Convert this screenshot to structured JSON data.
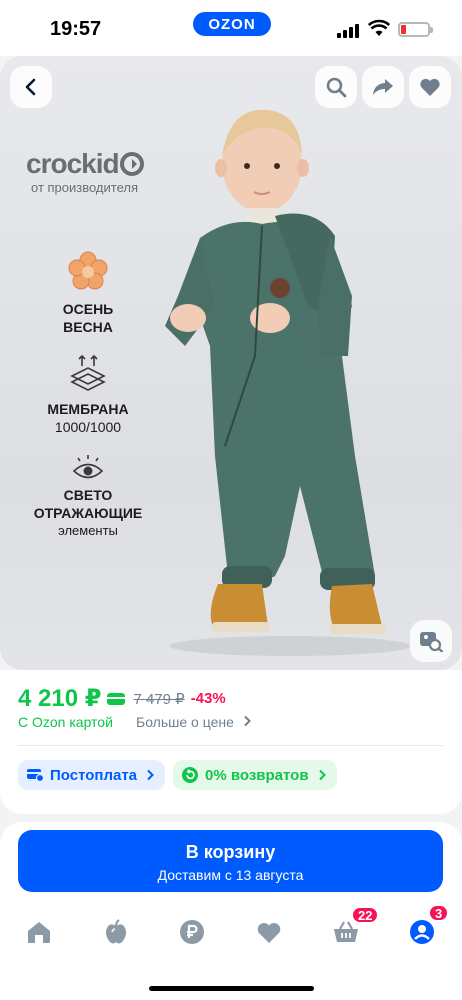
{
  "status": {
    "time": "19:57",
    "app_pill": "OZON"
  },
  "product": {
    "brand": "crockid",
    "brand_sub": "от производителя",
    "features": [
      {
        "icon": "flower-icon",
        "title_line1": "ОСЕНЬ",
        "title_line2": "ВЕСНА",
        "sub": ""
      },
      {
        "icon": "membrane-icon",
        "title_line1": "МЕМБРАНА",
        "title_line2": "1000/1000",
        "sub": ""
      },
      {
        "icon": "eye-icon",
        "title_line1": "СВЕТО",
        "title_line2": "ОТРАЖАЮЩИЕ",
        "sub": "элементы"
      }
    ]
  },
  "pricing": {
    "price": "4 210 ₽",
    "old_price": "7 479 ₽",
    "discount": "-43%",
    "ozon_card_label": "С Ozon картой",
    "more_about_price": "Больше о цене"
  },
  "chips": {
    "postpay": "Постоплата",
    "returns": "0% возвратов"
  },
  "buy": {
    "label": "В корзину",
    "delivery": "Доставим с 13 августа"
  },
  "nav": {
    "cart_count": "22",
    "profile_count": "3"
  },
  "colors": {
    "ozon_blue": "#005bff",
    "price_green": "#10c44c",
    "discount_pink": "#f91155"
  }
}
